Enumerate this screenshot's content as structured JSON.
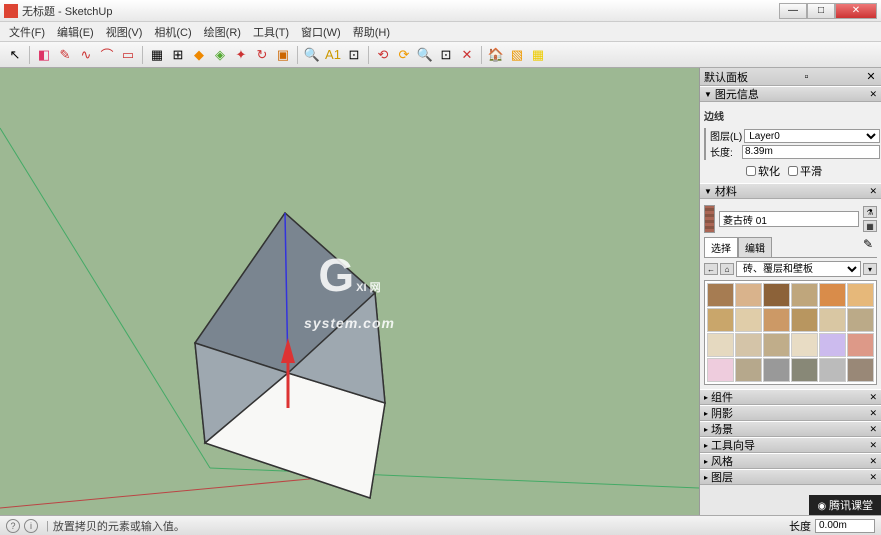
{
  "window": {
    "title": "无标题 - SketchUp"
  },
  "menu": [
    "文件(F)",
    "编辑(E)",
    "视图(V)",
    "相机(C)",
    "绘图(R)",
    "工具(T)",
    "窗口(W)",
    "帮助(H)"
  ],
  "toolbar_icons": [
    "select",
    "eraser",
    "pencil",
    "freehand",
    "arc",
    "rect",
    "paint",
    "measure",
    "move",
    "push",
    "rotate",
    "follow",
    "scale",
    "offset",
    "tape",
    "text",
    "protractor",
    "axes",
    "orbit",
    "pan",
    "zoom",
    "zoomext",
    "prev",
    "walk",
    "look",
    "section",
    "layers"
  ],
  "tray": {
    "title": "默认面板"
  },
  "panels": {
    "entity": {
      "title": "图元信息",
      "subtitle": "边线",
      "layer_label": "图层(L)",
      "layer_value": "Layer0",
      "length_label": "长度:",
      "length_value": "8.39m",
      "soften": "软化",
      "smooth": "平滑"
    },
    "materials": {
      "title": "材料",
      "current": "菱古砖 01",
      "tab_select": "选择",
      "tab_edit": "编辑",
      "category": "砖、覆层和壁板"
    },
    "collapsed": [
      "组件",
      "阴影",
      "场景",
      "工具向导",
      "风格",
      "图层"
    ]
  },
  "swatches": [
    [
      "#a67c52",
      "#d9b38c",
      "#8c6239",
      "#bfa67c",
      "#d98c4a",
      "#e6b87a"
    ],
    [
      "#c9a66b",
      "#e0cda9",
      "#c96",
      "#b89660",
      "#d9c7a3",
      "#ba8"
    ],
    [
      "#e5d9c0",
      "#d4c4a8",
      "#c0ad8a",
      "#e8dcc4",
      "#cbe",
      "#d98"
    ],
    [
      "#ecd",
      "#b6a88c",
      "#999",
      "#887",
      "#bbb",
      "#998877"
    ]
  ],
  "status": {
    "hint": "放置拷贝的元素或输入值。",
    "length_label": "长度",
    "length_value": "0.00m"
  },
  "badge": "腾讯课堂"
}
